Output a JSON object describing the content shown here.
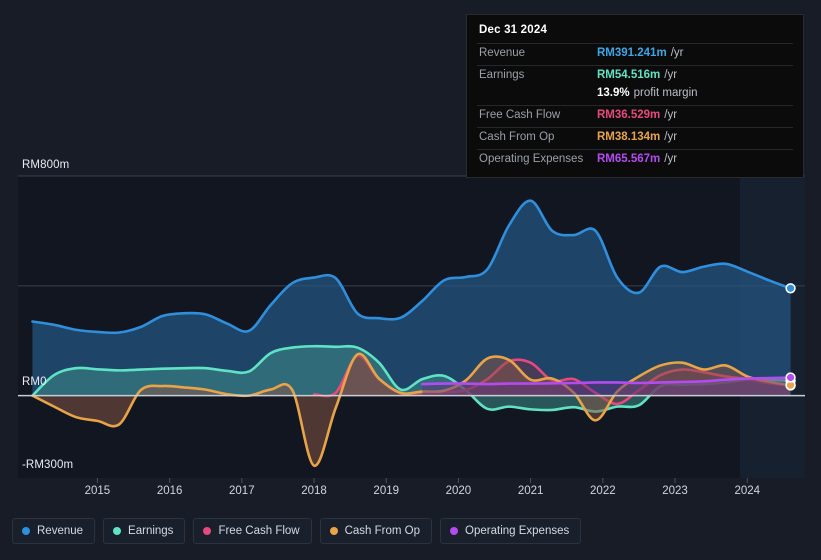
{
  "axes": {
    "y_top_label": "RM800m",
    "y_zero_label": "RM0",
    "y_bottom_label": "-RM300m",
    "x_labels": [
      "2015",
      "2016",
      "2017",
      "2018",
      "2019",
      "2020",
      "2021",
      "2022",
      "2023",
      "2024"
    ]
  },
  "tooltip": {
    "date": "Dec 31 2024",
    "rows": [
      {
        "label": "Revenue",
        "value": "RM391.241m",
        "unit": "/yr",
        "color": "#3ba7e8"
      },
      {
        "label": "Earnings",
        "value": "RM54.516m",
        "unit": "/yr",
        "color": "#5fe3c4"
      },
      {
        "label": "",
        "value": "13.9%",
        "unit": "profit margin",
        "color": "#ffffff"
      },
      {
        "label": "Free Cash Flow",
        "value": "RM36.529m",
        "unit": "/yr",
        "color": "#e8487f"
      },
      {
        "label": "Cash From Op",
        "value": "RM38.134m",
        "unit": "/yr",
        "color": "#e8a447"
      },
      {
        "label": "Operating Expenses",
        "value": "RM65.567m",
        "unit": "/yr",
        "color": "#b44bf0"
      }
    ]
  },
  "legend": [
    {
      "label": "Revenue",
      "color": "#2f8fdd"
    },
    {
      "label": "Earnings",
      "color": "#5fe3c4"
    },
    {
      "label": "Free Cash Flow",
      "color": "#e8487f"
    },
    {
      "label": "Cash From Op",
      "color": "#e8a447"
    },
    {
      "label": "Operating Expenses",
      "color": "#b44bf0"
    }
  ],
  "chart_data": {
    "type": "area",
    "title": "",
    "xlabel": "",
    "ylabel": "RM",
    "currency": "RM",
    "unit": "m",
    "ylim": [
      -300,
      800
    ],
    "xlim": [
      2014.4,
      2025.3
    ],
    "grid": true,
    "gridlines_y": [
      800,
      400,
      0
    ],
    "zero_line": 0,
    "legend_position": "bottom",
    "forecast_start": 2024.4,
    "series": [
      {
        "name": "Revenue",
        "color": "#2f8fdd",
        "fill": "rgba(36,86,131,0.72)",
        "x": [
          2014.6,
          2014.9,
          2015.2,
          2015.5,
          2015.8,
          2016.1,
          2016.4,
          2016.7,
          2017.0,
          2017.3,
          2017.6,
          2017.9,
          2018.2,
          2018.5,
          2018.8,
          2019.1,
          2019.4,
          2019.7,
          2020.0,
          2020.3,
          2020.6,
          2020.9,
          2021.2,
          2021.5,
          2021.8,
          2022.1,
          2022.4,
          2022.7,
          2023.0,
          2023.3,
          2023.6,
          2023.9,
          2024.2,
          2024.5,
          2024.8,
          2025.1
        ],
        "y": [
          270,
          258,
          240,
          232,
          230,
          250,
          290,
          300,
          296,
          262,
          236,
          330,
          410,
          430,
          428,
          300,
          282,
          284,
          345,
          420,
          432,
          460,
          620,
          710,
          600,
          585,
          600,
          430,
          375,
          470,
          450,
          470,
          480,
          452,
          420,
          391
        ]
      },
      {
        "name": "Earnings",
        "color": "#5fe3c4",
        "fill": "rgba(62,140,134,0.55)",
        "x": [
          2014.6,
          2014.9,
          2015.2,
          2015.5,
          2015.8,
          2016.1,
          2016.4,
          2016.7,
          2017.0,
          2017.3,
          2017.6,
          2017.9,
          2018.2,
          2018.5,
          2018.8,
          2019.1,
          2019.4,
          2019.7,
          2020.0,
          2020.3,
          2020.6,
          2020.9,
          2021.2,
          2021.5,
          2021.8,
          2022.1,
          2022.4,
          2022.7,
          2023.0,
          2023.3,
          2023.6,
          2023.9,
          2024.2,
          2024.5,
          2024.8,
          2025.1
        ],
        "y": [
          0,
          75,
          100,
          96,
          92,
          95,
          98,
          100,
          100,
          90,
          88,
          155,
          175,
          180,
          178,
          175,
          120,
          22,
          60,
          72,
          20,
          -48,
          -40,
          -50,
          -52,
          -42,
          -58,
          -40,
          -35,
          35,
          40,
          42,
          48,
          58,
          57,
          54
        ]
      },
      {
        "name": "Free Cash Flow",
        "color": "#e8487f",
        "fill": "rgba(120,52,68,0.45)",
        "x": [
          2018.5,
          2018.8,
          2019.1,
          2019.4,
          2019.7,
          2020.0,
          2020.3,
          2020.6,
          2020.9,
          2021.2,
          2021.5,
          2021.8,
          2022.1,
          2022.4,
          2022.7,
          2023.0,
          2023.3,
          2023.6,
          2023.9,
          2024.2,
          2024.5,
          2024.8,
          2025.1
        ],
        "y": [
          5,
          10,
          145,
          60,
          8,
          10,
          12,
          20,
          60,
          125,
          120,
          55,
          60,
          10,
          -30,
          20,
          75,
          95,
          85,
          70,
          60,
          45,
          37
        ]
      },
      {
        "name": "Cash From Op",
        "color": "#e8a447",
        "fill": "rgba(136,86,70,0.52)",
        "x": [
          2014.6,
          2014.9,
          2015.2,
          2015.5,
          2015.8,
          2016.1,
          2016.4,
          2016.7,
          2017.0,
          2017.3,
          2017.6,
          2017.9,
          2018.2,
          2018.5,
          2018.8,
          2019.1,
          2019.4,
          2019.7,
          2020.0,
          2020.3,
          2020.6,
          2020.9,
          2021.2,
          2021.5,
          2021.8,
          2022.1,
          2022.4,
          2022.7,
          2023.0,
          2023.3,
          2023.6,
          2023.9,
          2024.2,
          2024.5,
          2024.8,
          2025.1
        ],
        "y": [
          0,
          -40,
          -78,
          -92,
          -105,
          20,
          35,
          30,
          22,
          5,
          0,
          22,
          20,
          -255,
          -45,
          150,
          62,
          10,
          15,
          18,
          55,
          135,
          130,
          58,
          62,
          10,
          -90,
          15,
          70,
          110,
          120,
          95,
          110,
          70,
          50,
          38
        ]
      },
      {
        "name": "Operating Expenses",
        "color": "#b44bf0",
        "fill": "rgba(96,52,130,0.50)",
        "x": [
          2020.0,
          2020.3,
          2020.6,
          2020.9,
          2021.2,
          2021.5,
          2021.8,
          2022.1,
          2022.4,
          2022.7,
          2023.0,
          2023.3,
          2023.6,
          2023.9,
          2024.2,
          2024.5,
          2024.8,
          2025.1
        ],
        "y": [
          42,
          44,
          44,
          42,
          44,
          44,
          45,
          46,
          48,
          48,
          46,
          48,
          50,
          52,
          58,
          62,
          64,
          66
        ]
      }
    ]
  }
}
